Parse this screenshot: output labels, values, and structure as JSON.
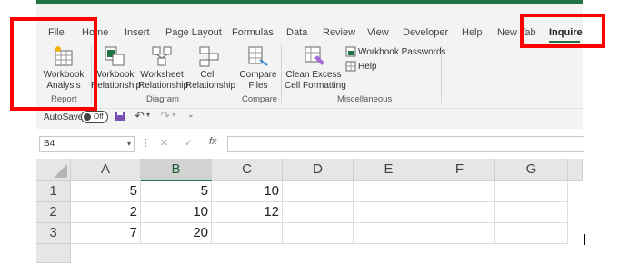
{
  "tabs": [
    "File",
    "Home",
    "Insert",
    "Page Layout",
    "Formulas",
    "Data",
    "Review",
    "View",
    "Developer",
    "Help",
    "New Tab",
    "Inquire"
  ],
  "active_tab": "Inquire",
  "ribbon": {
    "report": {
      "label": "Report",
      "workbook_analysis": [
        "Workbook",
        "Analysis"
      ]
    },
    "diagram": {
      "label": "Diagram",
      "workbook_relationship": [
        "Workbook",
        "Relationship"
      ],
      "worksheet_relationship": [
        "Worksheet",
        "Relationship"
      ],
      "cell_relationship": [
        "Cell",
        "Relationship"
      ]
    },
    "compare": {
      "label": "Compare",
      "compare_files": [
        "Compare",
        "Files"
      ]
    },
    "misc": {
      "label": "Miscellaneous",
      "clean_excess": [
        "Clean Excess",
        "Cell Formatting"
      ],
      "workbook_passwords": "Workbook Passwords",
      "help": "Help"
    }
  },
  "qat": {
    "autosave_label": "AutoSave",
    "autosave_state": "Off"
  },
  "formula_bar": {
    "name_box": "B4",
    "fx": "fx",
    "cancel": "✕",
    "enter": "✓",
    "value": ""
  },
  "columns": [
    "A",
    "B",
    "C",
    "D",
    "E",
    "F",
    "G"
  ],
  "rows": [
    {
      "num": "1",
      "cells": [
        "5",
        "5",
        "10",
        "",
        "",
        "",
        ""
      ]
    },
    {
      "num": "2",
      "cells": [
        "2",
        "10",
        "12",
        "",
        "",
        "",
        ""
      ]
    },
    {
      "num": "3",
      "cells": [
        "7",
        "20",
        "",
        "",
        "",
        "",
        ""
      ]
    }
  ],
  "selected_column": "B",
  "colors": {
    "excel_green": "#217346",
    "highlight_red": "#ff0000"
  }
}
